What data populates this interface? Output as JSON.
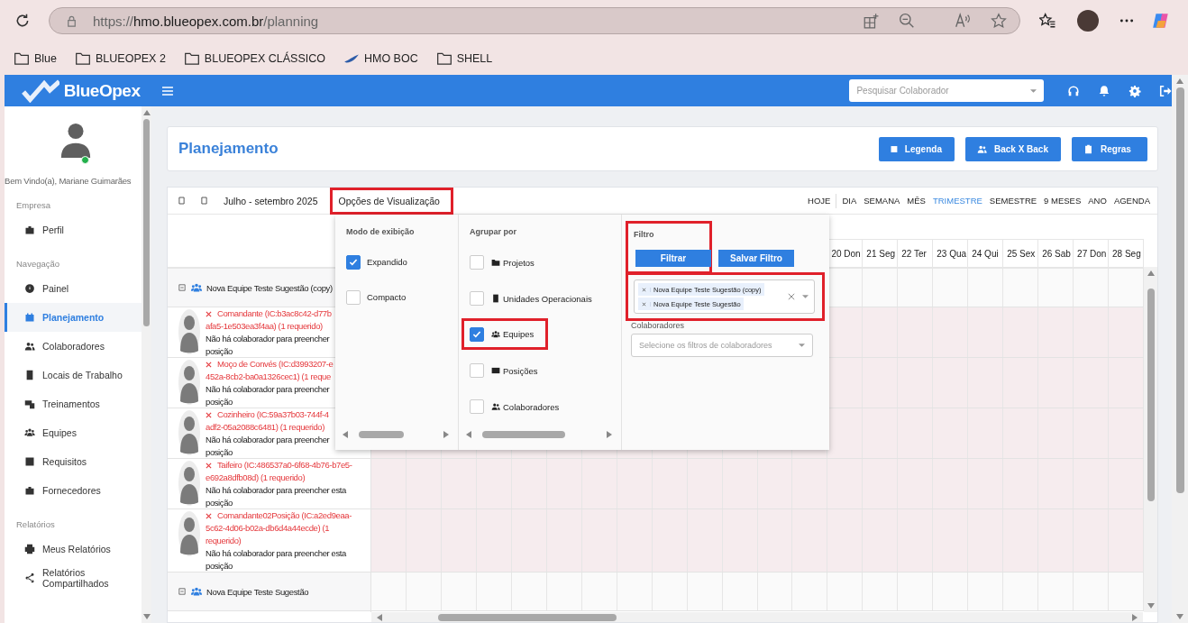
{
  "browser": {
    "url": {
      "scheme": "https://",
      "host": "hmo.blueopex.com.br",
      "path": "/planning"
    },
    "bookmarks": [
      {
        "label": "Blue",
        "kind": "folder"
      },
      {
        "label": "BLUEOPEX 2",
        "kind": "folder"
      },
      {
        "label": "BLUEOPEX CLÁSSICO",
        "kind": "folder"
      },
      {
        "label": "HMO BOC",
        "kind": "site"
      },
      {
        "label": "SHELL",
        "kind": "folder"
      }
    ]
  },
  "header": {
    "brand": "BlueOpex",
    "search": {
      "placeholder": "Pesquisar Colaborador"
    }
  },
  "sidebar": {
    "user": {
      "greeting": "Bem Vindo(a), Mariane Guimarães",
      "online": true
    },
    "sections": [
      {
        "title": "Empresa",
        "items": [
          {
            "label": "Perfil",
            "selected": false
          }
        ]
      },
      {
        "title": "Navegação",
        "items": [
          {
            "label": "Painel",
            "selected": false
          },
          {
            "label": "Planejamento",
            "selected": true
          },
          {
            "label": "Colaboradores",
            "selected": false
          },
          {
            "label": "Locais de Trabalho",
            "selected": false
          },
          {
            "label": "Treinamentos",
            "selected": false
          },
          {
            "label": "Equipes",
            "selected": false
          },
          {
            "label": "Requisitos",
            "selected": false
          },
          {
            "label": "Fornecedores",
            "selected": false
          }
        ]
      },
      {
        "title": "Relatórios",
        "items": [
          {
            "label": "Meus Relatórios",
            "selected": false
          },
          {
            "label": "Relatórios Compartilhados",
            "selected": false
          }
        ]
      }
    ]
  },
  "page": {
    "title": "Planejamento",
    "buttons": [
      "Legenda",
      "Back X Back",
      "Regras"
    ]
  },
  "calendar": {
    "range": "Julho - setembro 2025",
    "view_options": {
      "label": "Opções de Visualização",
      "highlighted": true,
      "open": true
    },
    "views": [
      {
        "label": "HOJE",
        "selected": false
      },
      {
        "label": "DIA",
        "selected": false
      },
      {
        "label": "SEMANA",
        "selected": false
      },
      {
        "label": "MÊS",
        "selected": false
      },
      {
        "label": "TRIMESTRE",
        "selected": true
      },
      {
        "label": "SEMESTRE",
        "selected": false
      },
      {
        "label": "9 MESES",
        "selected": false
      },
      {
        "label": "ANO",
        "selected": false
      },
      {
        "label": "AGENDA",
        "selected": false
      }
    ],
    "days": [
      "20 Don",
      "21 Seg",
      "22 Ter",
      "23 Qua",
      "24 Qui",
      "25 Sex",
      "26 Sab",
      "27 Don",
      "28 Seg"
    ],
    "groups": [
      {
        "name": "Nova Equipe Teste Sugestão (copy)",
        "expanded": true,
        "positions": [
          {
            "title_lines": [
              "Comandante (IC:b3ac8c42-d77b",
              "afa5-1e503ea3f4aa) (1 requerido)"
            ],
            "note_lines": [
              "Não há colaborador para preencher",
              "posição"
            ]
          },
          {
            "title_lines": [
              "Moço de Convés (IC:d3993207-e",
              "452a-8cb2-ba0a1326cec1) (1 reque"
            ],
            "note_lines": [
              "Não há colaborador para preencher",
              "posição"
            ]
          },
          {
            "title_lines": [
              "Cozinheiro (IC:59a37b03-744f-4",
              "adf2-05a2088c6481) (1 requerido)"
            ],
            "note_lines": [
              "Não há colaborador para preencher",
              "posição"
            ]
          },
          {
            "title_lines": [
              "Taifeiro (IC:486537a0-6f68-4b76-b7e5-",
              "e692a8dfb08d) (1 requerido)"
            ],
            "note_lines": [
              "Não há colaborador para preencher esta",
              "posição"
            ]
          },
          {
            "title_lines": [
              "Comandante02Posição (IC:a2ed9eaa-",
              "5c62-4d06-b02a-db6d4a44ecde) (1",
              "requerido)"
            ],
            "note_lines": [
              "Não há colaborador para preencher esta",
              "posição"
            ]
          }
        ]
      },
      {
        "name": "Nova Equipe Teste Sugestão",
        "expanded": true
      }
    ]
  },
  "view_options_panel": {
    "display_mode": {
      "title": "Modo de exibição",
      "options": [
        {
          "label": "Expandido",
          "checked": true
        },
        {
          "label": "Compacto",
          "checked": false
        }
      ]
    },
    "group_by": {
      "title": "Agrupar por",
      "options": [
        {
          "label": "Projetos",
          "checked": false,
          "highlighted": false
        },
        {
          "label": "Unidades Operacionais",
          "checked": false,
          "highlighted": false
        },
        {
          "label": "Equipes",
          "checked": true,
          "highlighted": true
        },
        {
          "label": "Posições",
          "checked": false,
          "highlighted": false
        },
        {
          "label": "Colaboradores",
          "checked": false,
          "highlighted": false
        }
      ]
    },
    "filter": {
      "title": "Filtro",
      "highlighted": true,
      "buttons": [
        "Filtrar",
        "Salvar Filtro"
      ],
      "teams_field": {
        "highlighted": true,
        "tags": [
          "Nova Equipe Teste Sugestão (copy)",
          "Nova Equipe Teste Sugestão"
        ]
      },
      "collaborators": {
        "label": "Colaboradores",
        "placeholder": "Selecione os filtros de colaboradores"
      }
    }
  }
}
